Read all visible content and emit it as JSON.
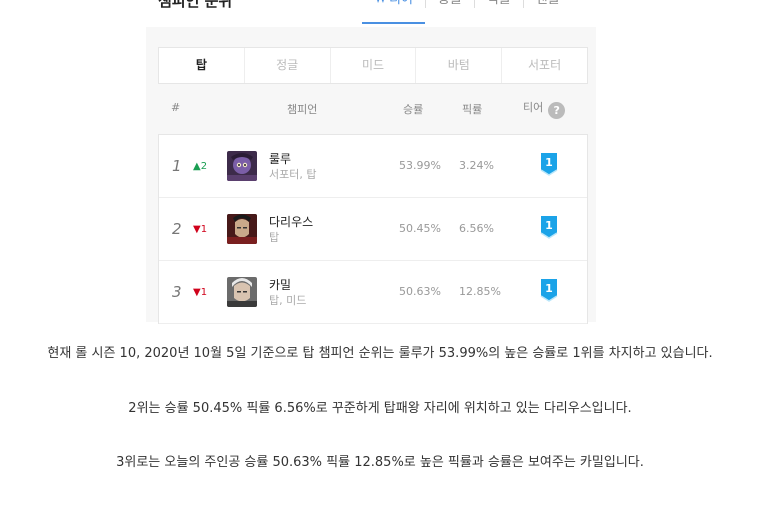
{
  "header": {
    "section_title": "챔피언 순위",
    "tabs": [
      {
        "label": "티어",
        "active": true
      },
      {
        "label": "승률",
        "active": false
      },
      {
        "label": "픽률",
        "active": false
      },
      {
        "label": "밴률",
        "active": false
      }
    ]
  },
  "positions": [
    {
      "label": "탑",
      "active": true
    },
    {
      "label": "정글",
      "active": false
    },
    {
      "label": "미드",
      "active": false
    },
    {
      "label": "바텀",
      "active": false
    },
    {
      "label": "서포터",
      "active": false
    }
  ],
  "columns": {
    "rank": "#",
    "champion": "챔피언",
    "winrate": "승률",
    "pickrate": "픽률",
    "tier": "티어",
    "help": "?"
  },
  "rows": [
    {
      "rank": "1",
      "change": "▲2",
      "change_dir": "up",
      "name": "룰루",
      "positions": "서포터, 탑",
      "winrate": "53.99%",
      "pickrate": "3.24%",
      "tier": "1"
    },
    {
      "rank": "2",
      "change": "▼1",
      "change_dir": "down",
      "name": "다리우스",
      "positions": "탑",
      "winrate": "50.45%",
      "pickrate": "6.56%",
      "tier": "1"
    },
    {
      "rank": "3",
      "change": "▼1",
      "change_dir": "down",
      "name": "카밀",
      "positions": "탑, 미드",
      "winrate": "50.63%",
      "pickrate": "12.85%",
      "tier": "1"
    }
  ],
  "colors": {
    "accent": "#4a90e2",
    "up": "#1a9e52",
    "down": "#d0021b"
  },
  "paragraphs": [
    "현재 롤 시즌 10, 2020년 10월 5일 기준으로 탑 챔피언 순위는 룰루가 53.99%의 높은 승률로 1위를 차지하고 있습니다.",
    "2위는 승률 50.45% 픽률 6.56%로 꾸준하게 탑패왕 자리에 위치하고 있는 다리우스입니다.",
    "3위로는 오늘의 주인공 승률 50.63% 픽률 12.85%로 높은 픽률과 승률은 보여주는 카밀입니다."
  ]
}
